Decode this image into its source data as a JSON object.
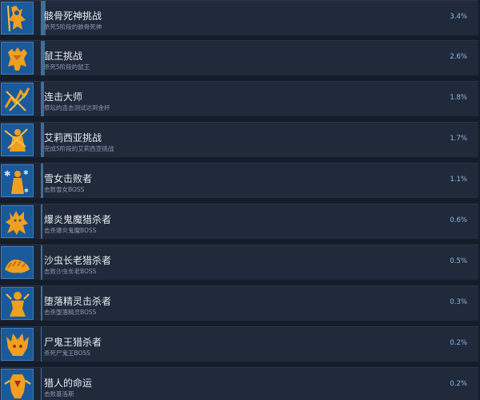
{
  "achievements": [
    {
      "title": "骸骨死神挑战",
      "desc": "杀死5阶段的骸骨死神",
      "percent": "3.4%",
      "icon": "skeleton-reaper-icon",
      "fill": 0.034
    },
    {
      "title": "鼠王挑战",
      "desc": "杀死5阶段的鼠王",
      "percent": "2.6%",
      "icon": "rat-king-icon",
      "fill": 0.026
    },
    {
      "title": "连击大师",
      "desc": "祭坛的连击测试达到金杯",
      "percent": "1.8%",
      "icon": "combo-master-icon",
      "fill": 0.018
    },
    {
      "title": "艾莉西亚挑战",
      "desc": "完成5阶段的艾莉西亚挑战",
      "percent": "1.7%",
      "icon": "alicia-icon",
      "fill": 0.017
    },
    {
      "title": "雪女击败者",
      "desc": "击败雪女BOSS",
      "percent": "1.1%",
      "icon": "snow-maiden-icon",
      "fill": 0.011
    },
    {
      "title": "爆炎鬼魔猎杀者",
      "desc": "击杀爆炎鬼魔BOSS",
      "percent": "0.6%",
      "icon": "flame-demon-icon",
      "fill": 0.006
    },
    {
      "title": "沙虫长老猎杀者",
      "desc": "击败沙虫长老BOSS",
      "percent": "0.5%",
      "icon": "sandworm-icon",
      "fill": 0.005
    },
    {
      "title": "堕落精灵击杀者",
      "desc": "击杀堕落精灵BOSS",
      "percent": "0.3%",
      "icon": "fallen-elf-icon",
      "fill": 0.003
    },
    {
      "title": "尸鬼王猎杀者",
      "desc": "杀死尸鬼王BOSS",
      "percent": "0.2%",
      "icon": "ghoul-king-icon",
      "fill": 0.002
    },
    {
      "title": "猎人的命运",
      "desc": "击败基洛斯",
      "percent": "0.2%",
      "icon": "hunter-fate-icon",
      "fill": 0.002
    }
  ],
  "colors": {
    "icon_bg": "#1a5a9a",
    "icon_fg": "#f0a020",
    "progress": "#3e6f96",
    "percent_text": "#8fb9e0"
  }
}
